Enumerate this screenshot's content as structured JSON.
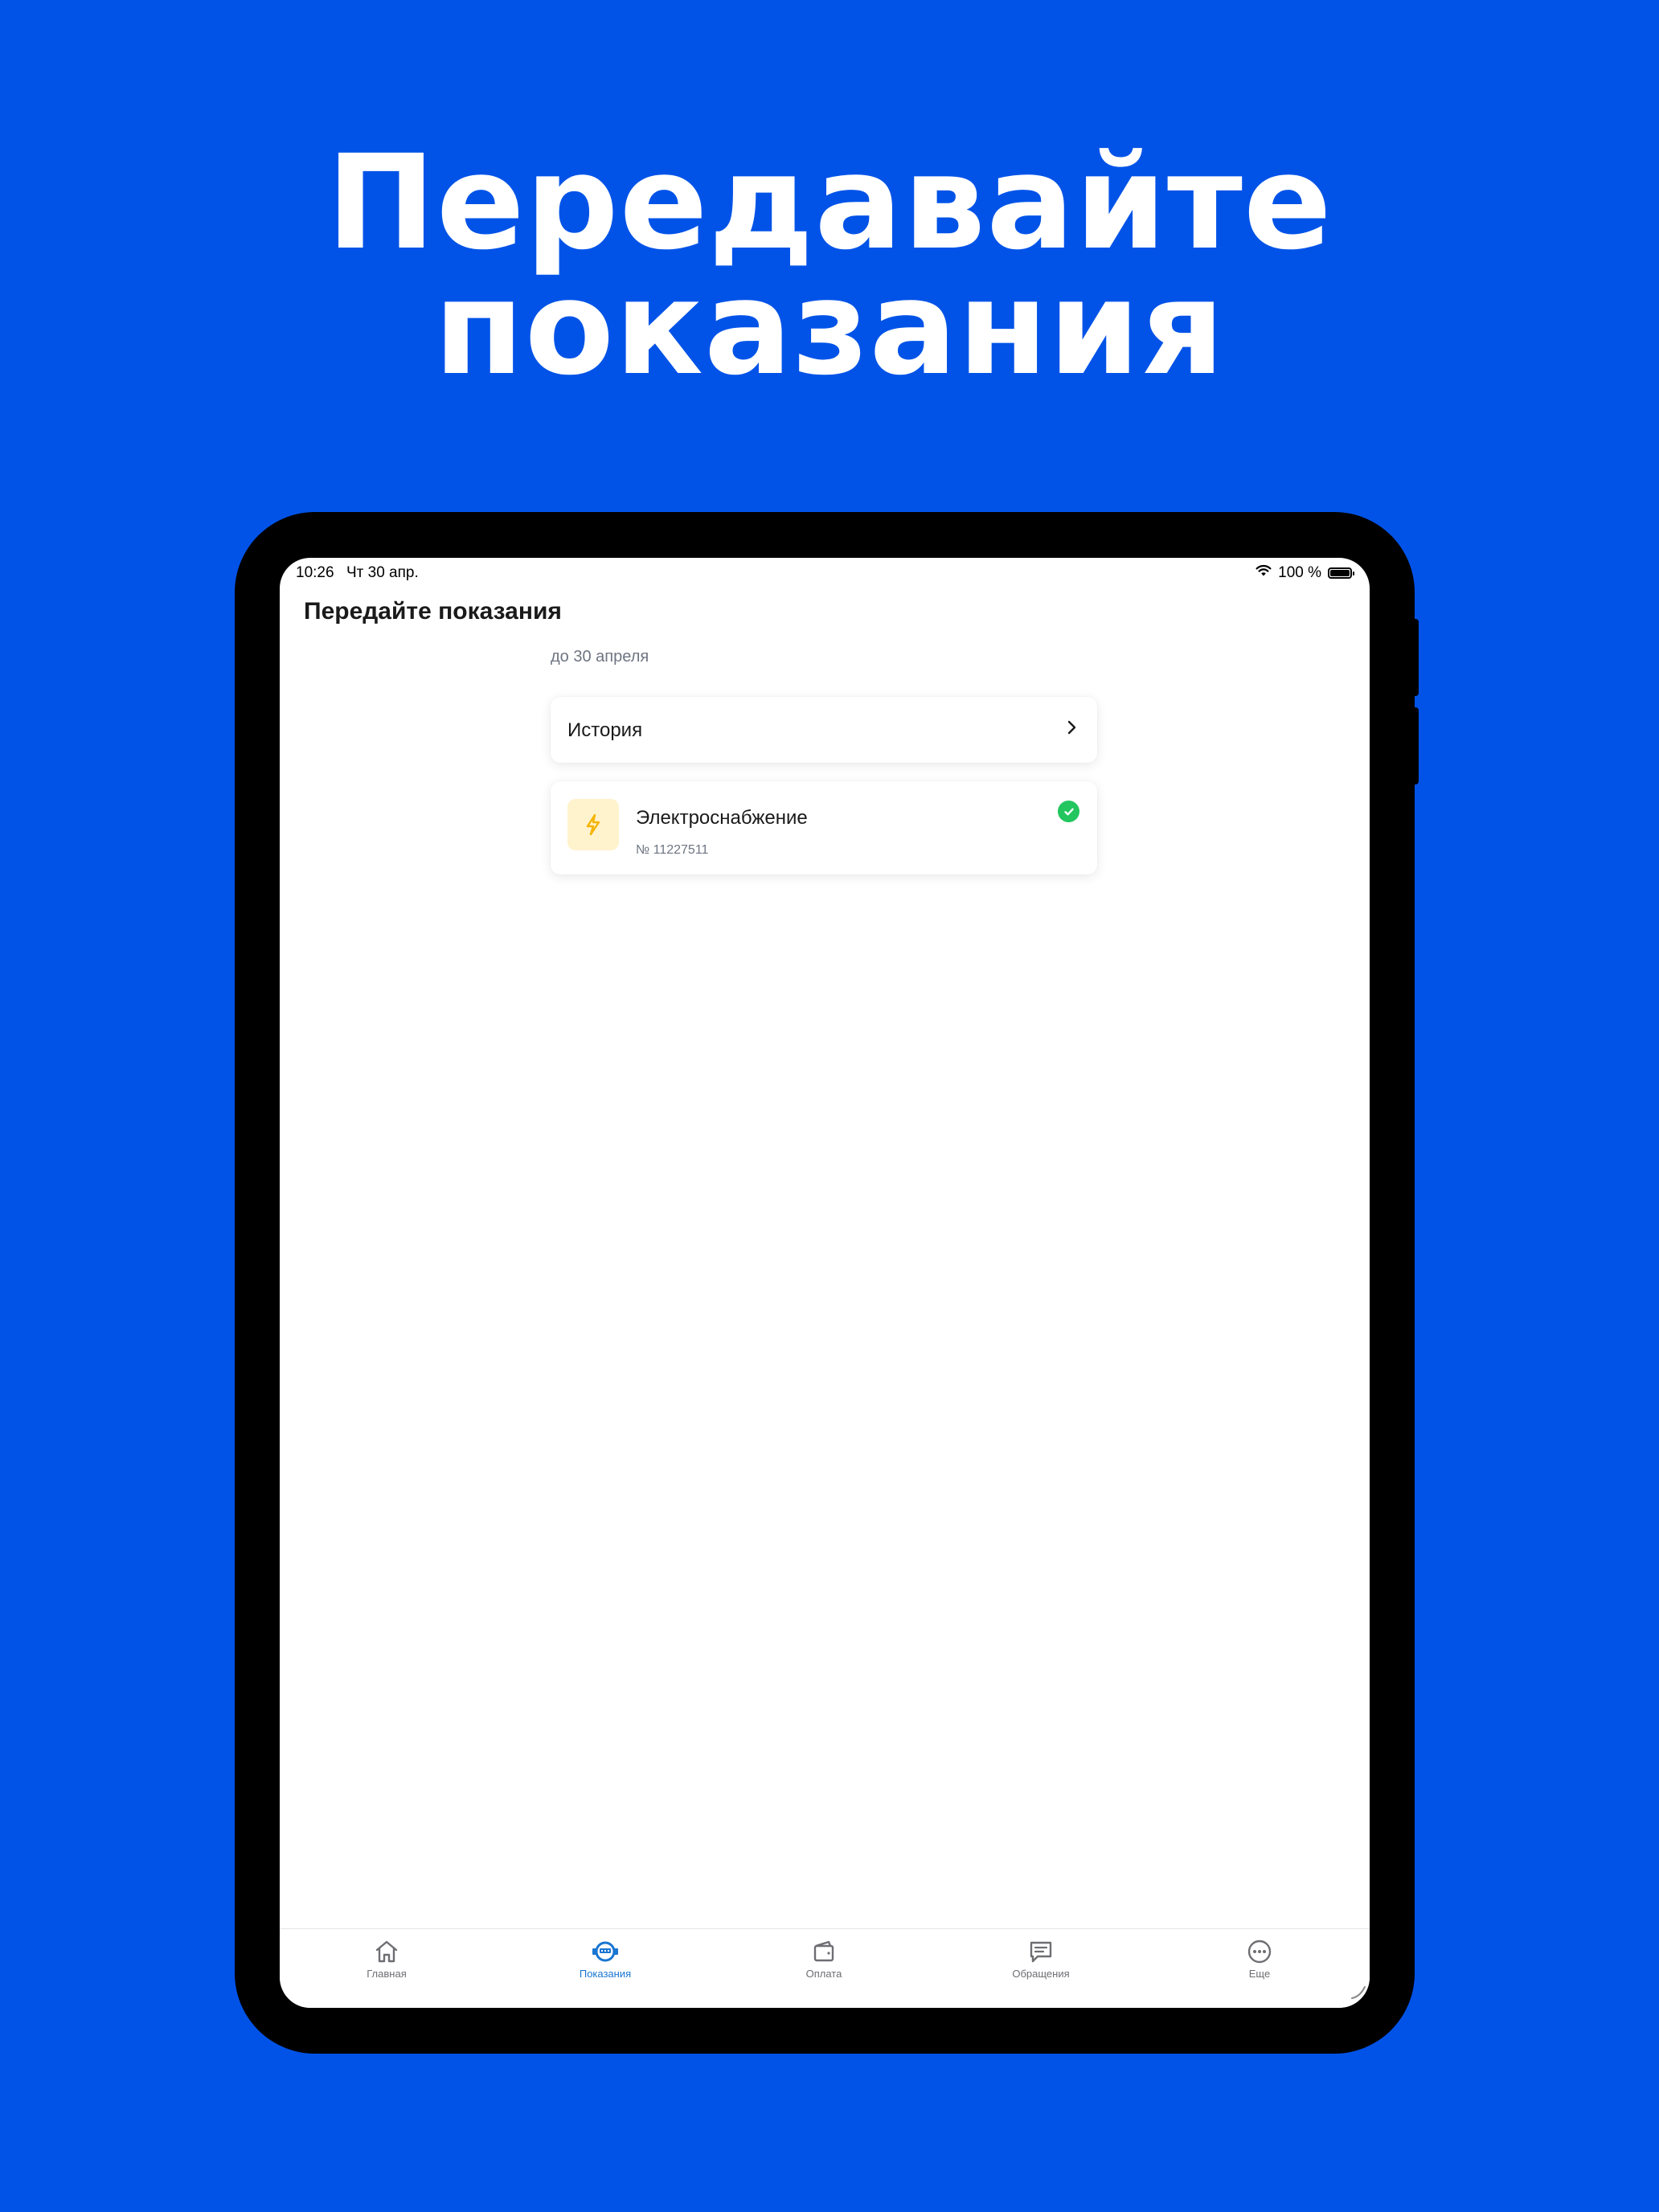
{
  "headline": {
    "line1": "Передавайте",
    "line2": "показания"
  },
  "status_bar": {
    "time": "10:26",
    "date": "Чт 30 апр.",
    "battery": "100 %"
  },
  "screen": {
    "title": "Передайте показания",
    "due_text": "до 30 апреля",
    "history_label": "История",
    "meter": {
      "title": "Электроснабжение",
      "number": "№ 11227511",
      "status": "done",
      "icon": "lightning-icon"
    }
  },
  "tabbar": {
    "tabs": [
      {
        "label": "Главная",
        "icon": "home-icon",
        "active": false
      },
      {
        "label": "Показания",
        "icon": "meter-icon",
        "active": true
      },
      {
        "label": "Оплата",
        "icon": "wallet-icon",
        "active": false
      },
      {
        "label": "Обращения",
        "icon": "message-icon",
        "active": false
      },
      {
        "label": "Еще",
        "icon": "more-icon",
        "active": false
      }
    ]
  },
  "colors": {
    "background": "#0153E8",
    "accent": "#1976D2",
    "success": "#22C55E",
    "meter_icon_bg": "#FFF3CD",
    "meter_icon": "#F5B400"
  }
}
